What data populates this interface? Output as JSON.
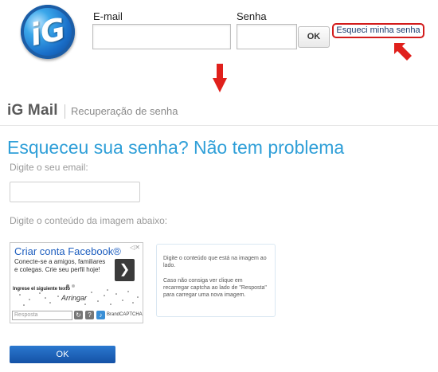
{
  "login": {
    "logo_text": "iG",
    "email_label": "E-mail",
    "password_label": "Senha",
    "ok_label": "OK",
    "forgot_link": "Esqueci minha senha"
  },
  "recovery": {
    "brand": "iG Mail",
    "section": "Recuperação de senha",
    "headline": "Esqueceu sua senha? Não tem problema",
    "email_prompt": "Digite o seu email:",
    "image_prompt": "Digite o conteúdo da imagem abaixo:",
    "captcha": {
      "ad_close": "◁✕",
      "ad_title": "Criar conta Facebook®",
      "ad_body": "Conecte-se a amigos, familiares e colegas. Crie seu perfil hoje!",
      "ad_arrow": "❯",
      "prompt_text": "Ingrese el siguiente texto",
      "word": "Arringar",
      "response_placeholder": "Resposta",
      "brand": "BrandCAPTCHA"
    },
    "help_text_1": "Digite o conteúdo que está na imagem ao lado.",
    "help_text_2": "Caso não consiga ver clique em recarregar captcha ao lado de \"Resposta\" para carregar uma nova imagem.",
    "submit_label": "OK"
  },
  "colors": {
    "accent_blue": "#2f9fd8",
    "button_blue": "#1552a6",
    "highlight_red": "#d21c1c"
  }
}
